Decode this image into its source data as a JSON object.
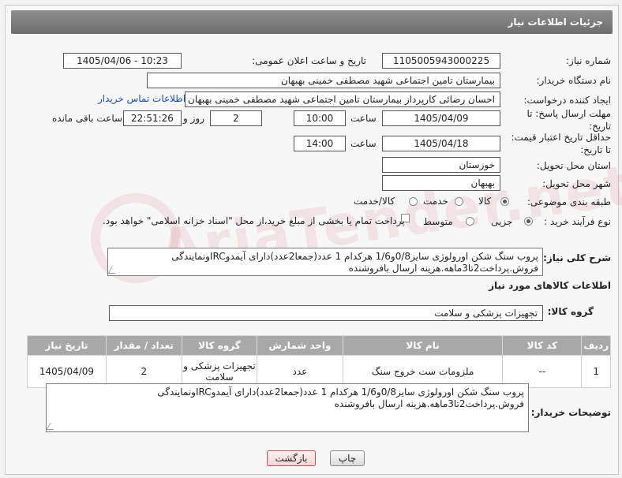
{
  "header": {
    "title": "جزئیات اطلاعات نیاز"
  },
  "fields": {
    "need_number_label": "شماره نیاز:",
    "need_number": "1105005943000225",
    "announce_label": "تاریخ و ساعت اعلان عمومی:",
    "announce_value": "1405/04/06 - 10:23",
    "buyer_org_label": "نام دستگاه خریدار:",
    "buyer_org": "بیمارستان تامین اجتماعی شهید مصطفی خمینی بهبهان",
    "creator_label": "ایجاد کننده درخواست:",
    "creator": "احسان رضائی کارپرداز بیمارستان تامین اجتماعی شهید مصطفی خمینی بهبهان",
    "buyer_contact_link": "اطلاعات تماس خریدار",
    "reply_deadline_label": "مهلت ارسال پاسخ: تا تاریخ:",
    "reply_date": "1405/04/09",
    "time_label": "ساعت",
    "reply_time": "10:00",
    "days_value": "2",
    "days_label": "روز و",
    "remaining_time": "22:51:26",
    "remaining_label": "ساعت باقی مانده",
    "price_validity_label": "حداقل تاریخ اعتبار قیمت: تا تاریخ:",
    "price_date": "1405/04/18",
    "price_time": "14:00",
    "province_label": "استان محل تحویل:",
    "province": "خوزستان",
    "city_label": "شهر محل تحویل:",
    "city": "بهبهان",
    "category_label": "طبقه بندی موضوعی:",
    "category_options": [
      "کالا",
      "خدمت",
      "کالا/خدمت"
    ],
    "process_label": "نوع فرآیند خرید :",
    "process_options": [
      "جزیی",
      "متوسط"
    ],
    "payment_note": "پرداخت تمام یا بخشی از مبلغ خرید،از محل \"اسناد خزانه اسلامی\" خواهد بود."
  },
  "description": {
    "label": "شرح کلی نیاز:",
    "text": "پروب سنگ شکن اورولوژی سایز0/8و1/6 هرکدام 1 عدد(جمعا2عدد)دارای آیمدوIRCونمایندگی فروش.پرداخت2تا3ماهه.هزینه ارسال بافروشنده"
  },
  "goods_section": {
    "title": "اطلاعات کالاهای مورد نیاز",
    "group_label": "گروه کالا:",
    "group_value": "تجهیزات پزشکی و سلامت"
  },
  "table": {
    "headers": [
      "ردیف",
      "کد کالا",
      "نام کالا",
      "واحد شمارش",
      "گروه کالا",
      "تعداد / مقدار",
      "تاریخ نیاز"
    ],
    "rows": [
      [
        "1",
        "--",
        "ملزومات ست خروج سنگ",
        "عدد",
        "تجهیزات پزشکی و سلامت",
        "2",
        "1405/04/09"
      ]
    ]
  },
  "buyer_notes": {
    "label": "توضیحات خریدار:",
    "text": "پروب سنگ شکن اورولوژی سایز0/8و1/6 هرکدام 1 عدد(جمعا2عدد)دارای آیمدوIRCونمایندگی فروش.پرداخت2تا3ماهه.هزینه ارسال بافروشنده"
  },
  "buttons": {
    "print": "چاپ",
    "back": "بازگشت"
  },
  "watermark": "AriaTender.net",
  "colors": {
    "header_bg": "#7a7a7a",
    "table_header_bg": "#a8a8a8",
    "link": "#1a4fb5",
    "back_button_border": "#c05050"
  }
}
